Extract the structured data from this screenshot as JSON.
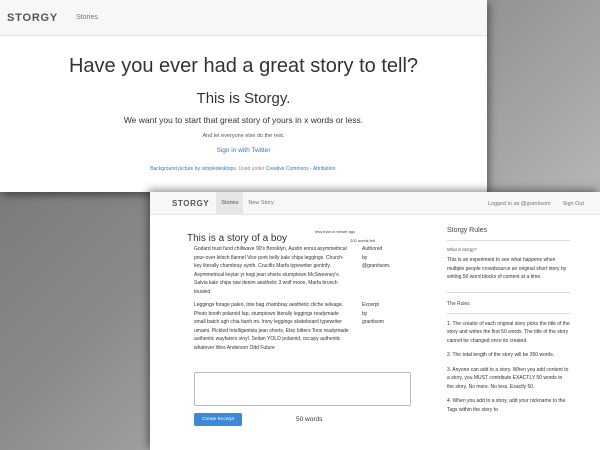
{
  "landing": {
    "brand": "STORGY",
    "nav_stories": "Stories",
    "headline": "Have you ever had a great story to tell?",
    "subheadline": "This is Storgy.",
    "lead": "We want you to start that great story of yours in x words or less.",
    "small": "And let everyone else do the rest.",
    "signin": "Sign in with Twitter",
    "credit_link1": "Background picture by simpledesktops",
    "credit_mid": ". Used under ",
    "credit_link2": "Creative Commons - Attribution",
    "credit_end": "."
  },
  "story": {
    "brand": "STORGY",
    "tabs": [
      "Stories",
      "New Story"
    ],
    "logged_in": "Logged in as @grantisom",
    "sign_out": "Sign Out",
    "title": "This is a story of a boy",
    "time_ago": "less than a minute ago",
    "words_left": "202 words left",
    "excerpts": [
      {
        "text": "Godard trust fund chillwave 90's Brooklyn, Austin ennui asymmetrical pour-over kitsch flannel Vice pork belly kale chips leggings. Church-key literally chambray synth. Crucifix Marfa typewriter gentrify. Asymmetrical keytar yr kogi jean shorts stumptown McSweeney's. Salvia kale chips raw denim aesthetic 3 wolf moon, Marfa brunch tousled",
        "by_label": "Authored",
        "by_word": "by",
        "by_user": "@grantisom."
      },
      {
        "text": "Leggings forage paleo, tote bag chambray aesthetic cliche selvage. Photo booth polaroid fap, stumptown literally leggings readymade small batch ugh chia banh mi. Irony leggings skateboard typewriter umami. Pickled Intelligentsia jean shorts, Etsy bitters Tonx readymade authentic wayfarers vinyl. Seitan YOLO polaroid, occupy authentic whatever Wes Anderson Odd Future",
        "by_label": "Excerpt",
        "by_word": "by",
        "by_user": "grantisom"
      }
    ],
    "button": "Create Excerpt",
    "word_count": "50 words",
    "sidebar": {
      "title": "Storgy Rules",
      "question": "What is Storgy?",
      "intro": "This is an experiment to see what happens when multiple people crowdsource an original short story by writing 50 word blocks of content at a time.",
      "rules_heading": "The Rules",
      "rules": [
        "1. The creator of each original story picks the title of the story and writes the first 50 words. The title of the story cannot be changed once its created.",
        "2. The total length of the story will be 350 words.",
        "3. Anyone can add to a story. When you add content to a story, you MUST contribute EXACTLY 50 words to the story. No more. No less. Exactly 50.",
        "4. When you add to a story, add your nickname to the Tags within the story to"
      ]
    }
  }
}
